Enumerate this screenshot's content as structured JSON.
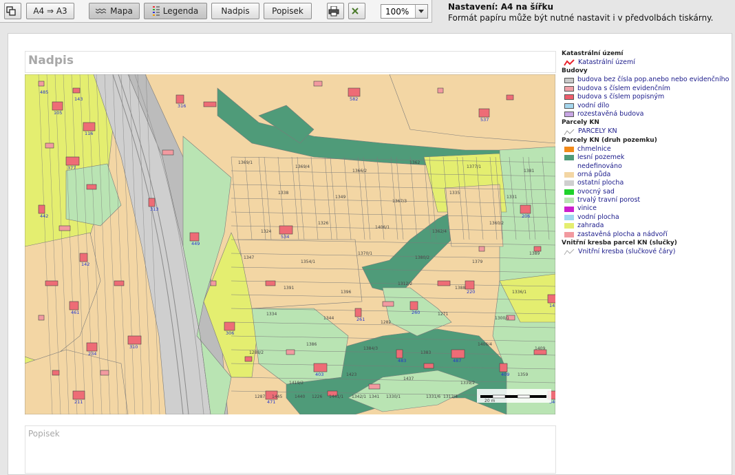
{
  "toolbar": {
    "copy_label": "",
    "format_label": "A4 ⇒ A3",
    "map_label": "Mapa",
    "legend_label": "Legenda",
    "title_label": "Nadpis",
    "caption_label": "Popisek",
    "print_label": "",
    "close_label": "",
    "zoom_value": "100%"
  },
  "info": {
    "heading": "Nastavení: A4 na šířku",
    "text": "Formát papíru může být nutné nastavit i v předvolbách tiskárny."
  },
  "page": {
    "title_placeholder": "Nadpis",
    "caption_placeholder": "Popisek"
  },
  "legend": {
    "sections": [
      {
        "heading": "Katastrální území",
        "items": [
          {
            "label": "Katastrální území",
            "kind": "red-line",
            "color": "#e8202a"
          }
        ]
      },
      {
        "heading": "Budovy",
        "items": [
          {
            "label": "budova bez čísla pop.anebo nebo evidenčního",
            "kind": "box",
            "color": "#c9c9c9"
          },
          {
            "label": "budova s číslem evidenčním",
            "kind": "box",
            "color": "#f0a0a8"
          },
          {
            "label": "budova s číslem popisným",
            "kind": "box",
            "color": "#ee5d6c"
          },
          {
            "label": "vodní dílo",
            "kind": "box",
            "color": "#a6d7ee"
          },
          {
            "label": "rozestavěná budova",
            "kind": "box",
            "color": "#c8a6e4"
          }
        ]
      },
      {
        "heading": "Parcely KN",
        "items": [
          {
            "label": "PARCELY KN",
            "kind": "grey-line",
            "color": "#999999"
          }
        ]
      },
      {
        "heading": "Parcely KN (druh pozemku)",
        "items": [
          {
            "label": "chmelnice",
            "kind": "fill",
            "color": "#f28a1a"
          },
          {
            "label": "lesní pozemek",
            "kind": "fill",
            "color": "#4f9b79"
          },
          {
            "label": "nedefinováno",
            "kind": "none",
            "color": ""
          },
          {
            "label": "orná půda",
            "kind": "fill",
            "color": "#f3d6a4"
          },
          {
            "label": "ostatní plocha",
            "kind": "fill",
            "color": "#cfcfcf"
          },
          {
            "label": "ovocný sad",
            "kind": "fill",
            "color": "#1fd22b"
          },
          {
            "label": "trvalý travní porost",
            "kind": "fill",
            "color": "#b9e4b3"
          },
          {
            "label": "vinice",
            "kind": "fill",
            "color": "#cc1fcc"
          },
          {
            "label": "vodní plocha",
            "kind": "fill",
            "color": "#9fd8f0"
          },
          {
            "label": "zahrada",
            "kind": "fill",
            "color": "#e4ee70"
          },
          {
            "label": "zastavěná plocha a nádvoří",
            "kind": "fill",
            "color": "#f29aa0"
          }
        ]
      },
      {
        "heading": "Vnitřní kresba parcel KN (slučky)",
        "items": [
          {
            "label": "Vnitřní kresba (slučkové čáry)",
            "kind": "grey-line",
            "color": "#aaaaaa"
          }
        ]
      }
    ]
  },
  "map": {
    "colors": {
      "arable": "#f3d6a4",
      "forest": "#4f9b79",
      "meadow": "#b9e4b3",
      "garden": "#e4ee70",
      "other": "#cfcfcf",
      "built": "#ee6c76",
      "parcel_line": "#7a7a7a",
      "number": "#2233cc"
    },
    "parcel_numbers": [
      "1369/1",
      "1369/4",
      "1366/2",
      "1362",
      "1377/1",
      "1381",
      "1338",
      "1349",
      "1367/3",
      "1335",
      "1331",
      "1324",
      "1326",
      "1406/1",
      "1362/4",
      "1360/2",
      "1347",
      "1354/1",
      "1370/1",
      "1380/2",
      "1379",
      "1389",
      "1391",
      "1396",
      "1312/2",
      "1388",
      "1336/1",
      "1334",
      "1344",
      "1282",
      "1271",
      "1300/1",
      "1288/2",
      "1386",
      "1384/3",
      "1383",
      "1406/4",
      "1409",
      "1419/2",
      "1423",
      "1437",
      "1339/2",
      "1359",
      "1445",
      "1441/1",
      "1330/1",
      "1312/4",
      "1277/3",
      "1287",
      "1226",
      "1341",
      "1331/6",
      "1329",
      "1430",
      "1440",
      "1342/1"
    ],
    "house_numbers": [
      "105",
      "116",
      "377",
      "442",
      "142",
      "461",
      "234",
      "211",
      "310",
      "313",
      "316",
      "449",
      "306",
      "471",
      "403",
      "261",
      "260",
      "220",
      "206",
      "145",
      "487",
      "483",
      "409",
      "346",
      "537",
      "582",
      "534",
      "485",
      "143"
    ],
    "scale_label": "20 m"
  }
}
